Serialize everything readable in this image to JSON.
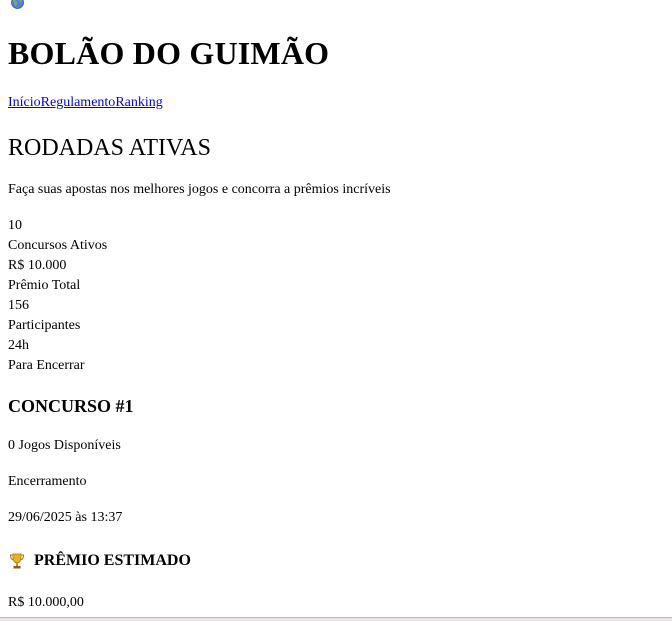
{
  "header": {
    "logo_icon": "globe-icon",
    "title": "BOLÃO DO GUIMÃO"
  },
  "nav": {
    "items": [
      {
        "label": "Início"
      },
      {
        "label": "Regulamento"
      },
      {
        "label": "Ranking"
      }
    ]
  },
  "main": {
    "section_title": "RODADAS ATIVAS",
    "subtitle": "Faça suas apostas nos melhores jogos e concorra a prêmios incríveis",
    "stats": [
      {
        "value": "10",
        "label": "Concursos Ativos"
      },
      {
        "value": "R$ 10.000",
        "label": "Prêmio Total"
      },
      {
        "value": "156",
        "label": "Participantes"
      },
      {
        "value": "24h",
        "label": "Para Encerrar"
      }
    ]
  },
  "contest": {
    "title": "CONCURSO #1",
    "games": "0 Jogos Disponíveis",
    "closing_label": "Encerramento",
    "closing_date": "29/06/2025 às 13:37",
    "prize_icon": "trophy-icon",
    "prize_title": "PRÊMIO ESTIMADO",
    "prize_value": "R$ 10.000,00"
  },
  "colors": {
    "link": "#0000ee",
    "bottom_strip": "#f2dfe8"
  }
}
